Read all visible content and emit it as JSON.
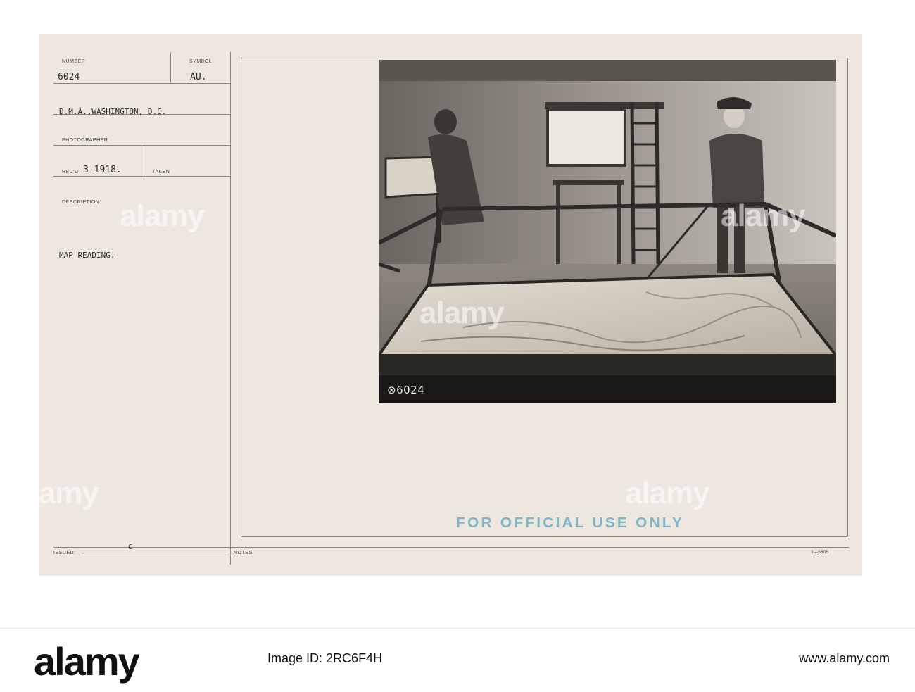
{
  "card": {
    "number_label": "NUMBER",
    "number": "6024",
    "symbol_label": "SYMBOL",
    "symbol": "AU.",
    "source": "D.M.A.,WASHINGTON, D.C.",
    "photographer_label": "PHOTOGRAPHER",
    "recd_label": "REC'D",
    "recd": "3-1918.",
    "taken_label": "TAKEN",
    "description_label": "DESCRIPTION:",
    "description": "MAP READING.",
    "issued_label": "ISSUED:",
    "issued_mark": "C",
    "notes_label": "NOTES:",
    "form_code": "3—5605",
    "stamp": "FOR OFFICIAL USE ONLY",
    "photo_number": "⊗6024"
  },
  "watermark": {
    "text": "alamy"
  },
  "footer": {
    "logo": "alamy",
    "image_id_label": "Image ID:",
    "image_id": "2RC6F4H",
    "site": "www.alamy.com"
  }
}
